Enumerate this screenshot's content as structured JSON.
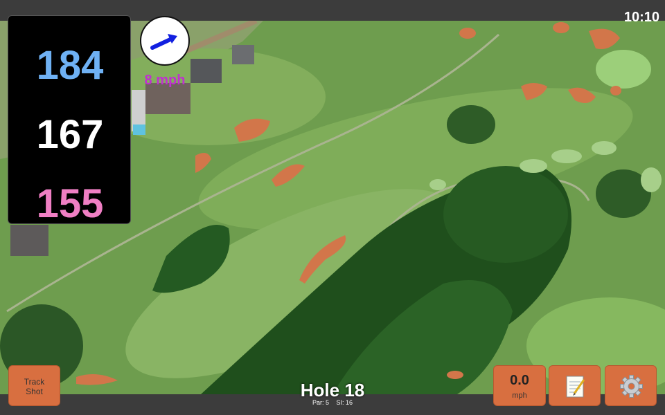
{
  "status_bar": {
    "time": "10:10"
  },
  "distances": {
    "back": "184",
    "middle": "167",
    "front": "155"
  },
  "wind": {
    "speed_label": "8 mph",
    "direction_icon": "arrow-right-icon"
  },
  "hole": {
    "title": "Hole 18",
    "par_label": "Par: 5",
    "si_label": "SI: 16"
  },
  "buttons": {
    "track_shot_line1": "Track",
    "track_shot_line2": "Shot",
    "speed_value": "0.0",
    "speed_unit": "mph",
    "notes_icon": "notepad-icon",
    "settings_icon": "gear-icon"
  },
  "colors": {
    "back_distance": "#6fb1f4",
    "middle_distance": "#ffffff",
    "front_distance": "#f07fc4",
    "wind_label": "#c030d0",
    "button_accent": "#d86f40"
  }
}
